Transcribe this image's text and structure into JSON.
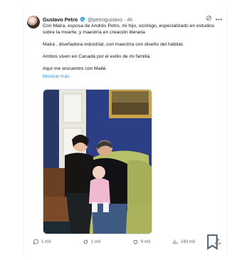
{
  "post": {
    "author_name": "Gustavo Petro",
    "author_handle": "@petrogustavo",
    "separator": "·",
    "time": "4h",
    "paragraphs": [
      "Con Maira, esposa de Andrés Petro, mi hijo, sicólogo, especializado en estudios sobre la muerte, y maestría en creación literaria",
      "Maira , diseñadora industrial, con maestría con diseño del hábitat.",
      "Ambos viven en Canadá por el exilio de mi familia.",
      "Aquí me encuentro con Mailé."
    ],
    "show_more": "Mostrar más"
  },
  "actions": {
    "replies": "1 mil",
    "reposts": "1 mil",
    "likes": "9 mil",
    "views": "243 mil"
  },
  "colors": {
    "accent": "#1d9bf0",
    "text": "#0f1419",
    "muted": "#536471"
  }
}
